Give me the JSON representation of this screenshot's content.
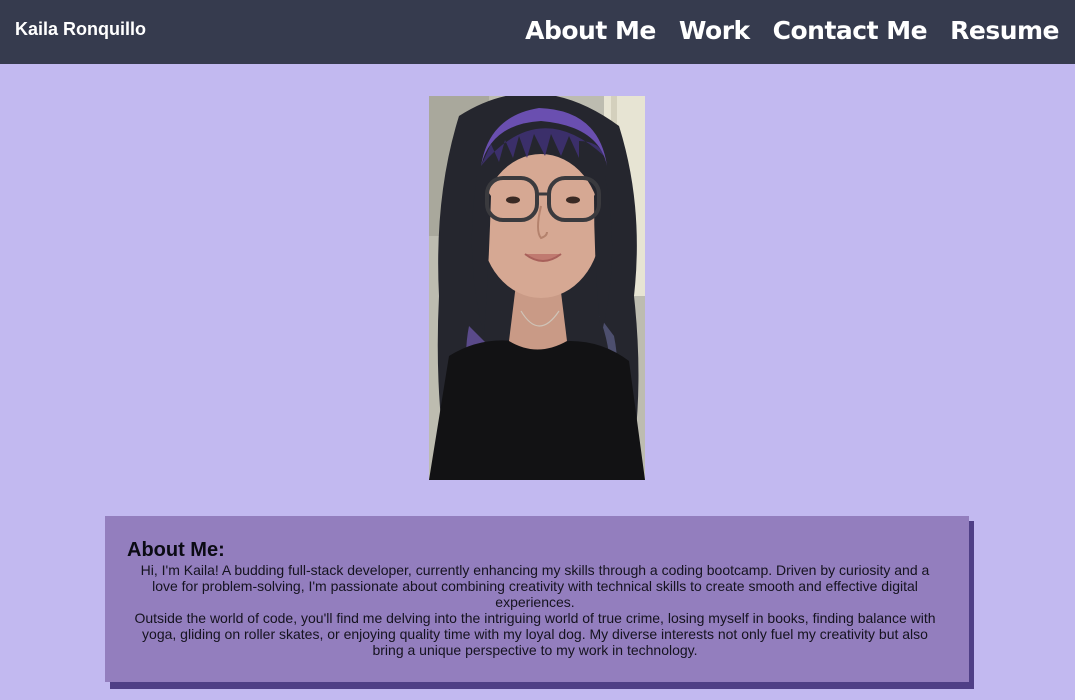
{
  "header": {
    "brand": "Kaila Ronquillo",
    "nav": [
      "About Me",
      "Work",
      "Contact Me",
      "Resume"
    ]
  },
  "profile_photo": {
    "alt": "Kaila Ronquillo"
  },
  "about": {
    "heading": "About Me:",
    "paragraph1": "Hi, I'm Kaila! A budding full-stack developer, currently enhancing my skills through a coding bootcamp. Driven by curiosity and a love for problem-solving, I'm passionate about combining creativity with technical skills to create smooth and effective digital experiences.",
    "paragraph2": "Outside the world of code, you'll find me delving into the intriguing world of true crime, losing myself in books, finding balance with yoga, gliding on roller skates, or enjoying quality time with my loyal dog. My diverse interests not only fuel my creativity but also bring a unique perspective to my work in technology."
  },
  "colors": {
    "page_background": "#c2b9f0",
    "header_background": "#363b4e",
    "card_background": "#937ebe",
    "card_shadow": "#4f3f86"
  }
}
